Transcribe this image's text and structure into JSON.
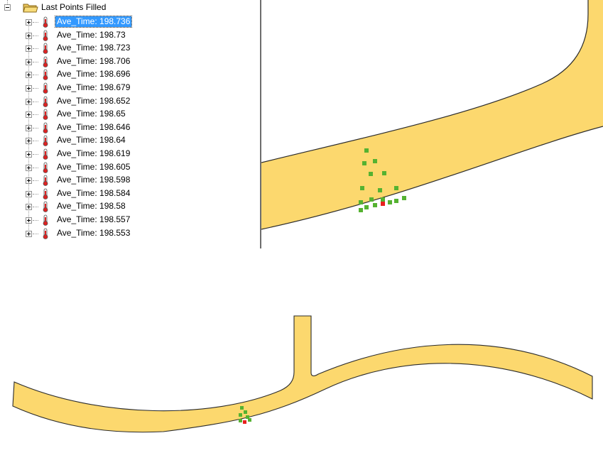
{
  "tree": {
    "root_label": "Last Points Filled",
    "items": [
      {
        "label": "Ave_Time: 198.736",
        "selected": true
      },
      {
        "label": "Ave_Time: 198.73"
      },
      {
        "label": "Ave_Time: 198.723"
      },
      {
        "label": "Ave_Time: 198.706"
      },
      {
        "label": "Ave_Time: 198.696"
      },
      {
        "label": "Ave_Time: 198.679"
      },
      {
        "label": "Ave_Time: 198.652"
      },
      {
        "label": "Ave_Time: 198.65"
      },
      {
        "label": "Ave_Time: 198.646"
      },
      {
        "label": "Ave_Time: 198.64"
      },
      {
        "label": "Ave_Time: 198.619"
      },
      {
        "label": "Ave_Time: 198.605"
      },
      {
        "label": "Ave_Time: 198.598"
      },
      {
        "label": "Ave_Time: 198.584"
      },
      {
        "label": "Ave_Time: 198.58"
      },
      {
        "label": "Ave_Time: 198.557"
      },
      {
        "label": "Ave_Time: 198.553"
      }
    ]
  },
  "icons": {
    "folder": "folder-icon",
    "item": "thermometer-icon"
  },
  "colors": {
    "part_fill": "#fcd86e",
    "outline": "#2b2b2b",
    "point_green": "#55b231",
    "point_red": "#e82020",
    "selection": "#3399ff"
  }
}
